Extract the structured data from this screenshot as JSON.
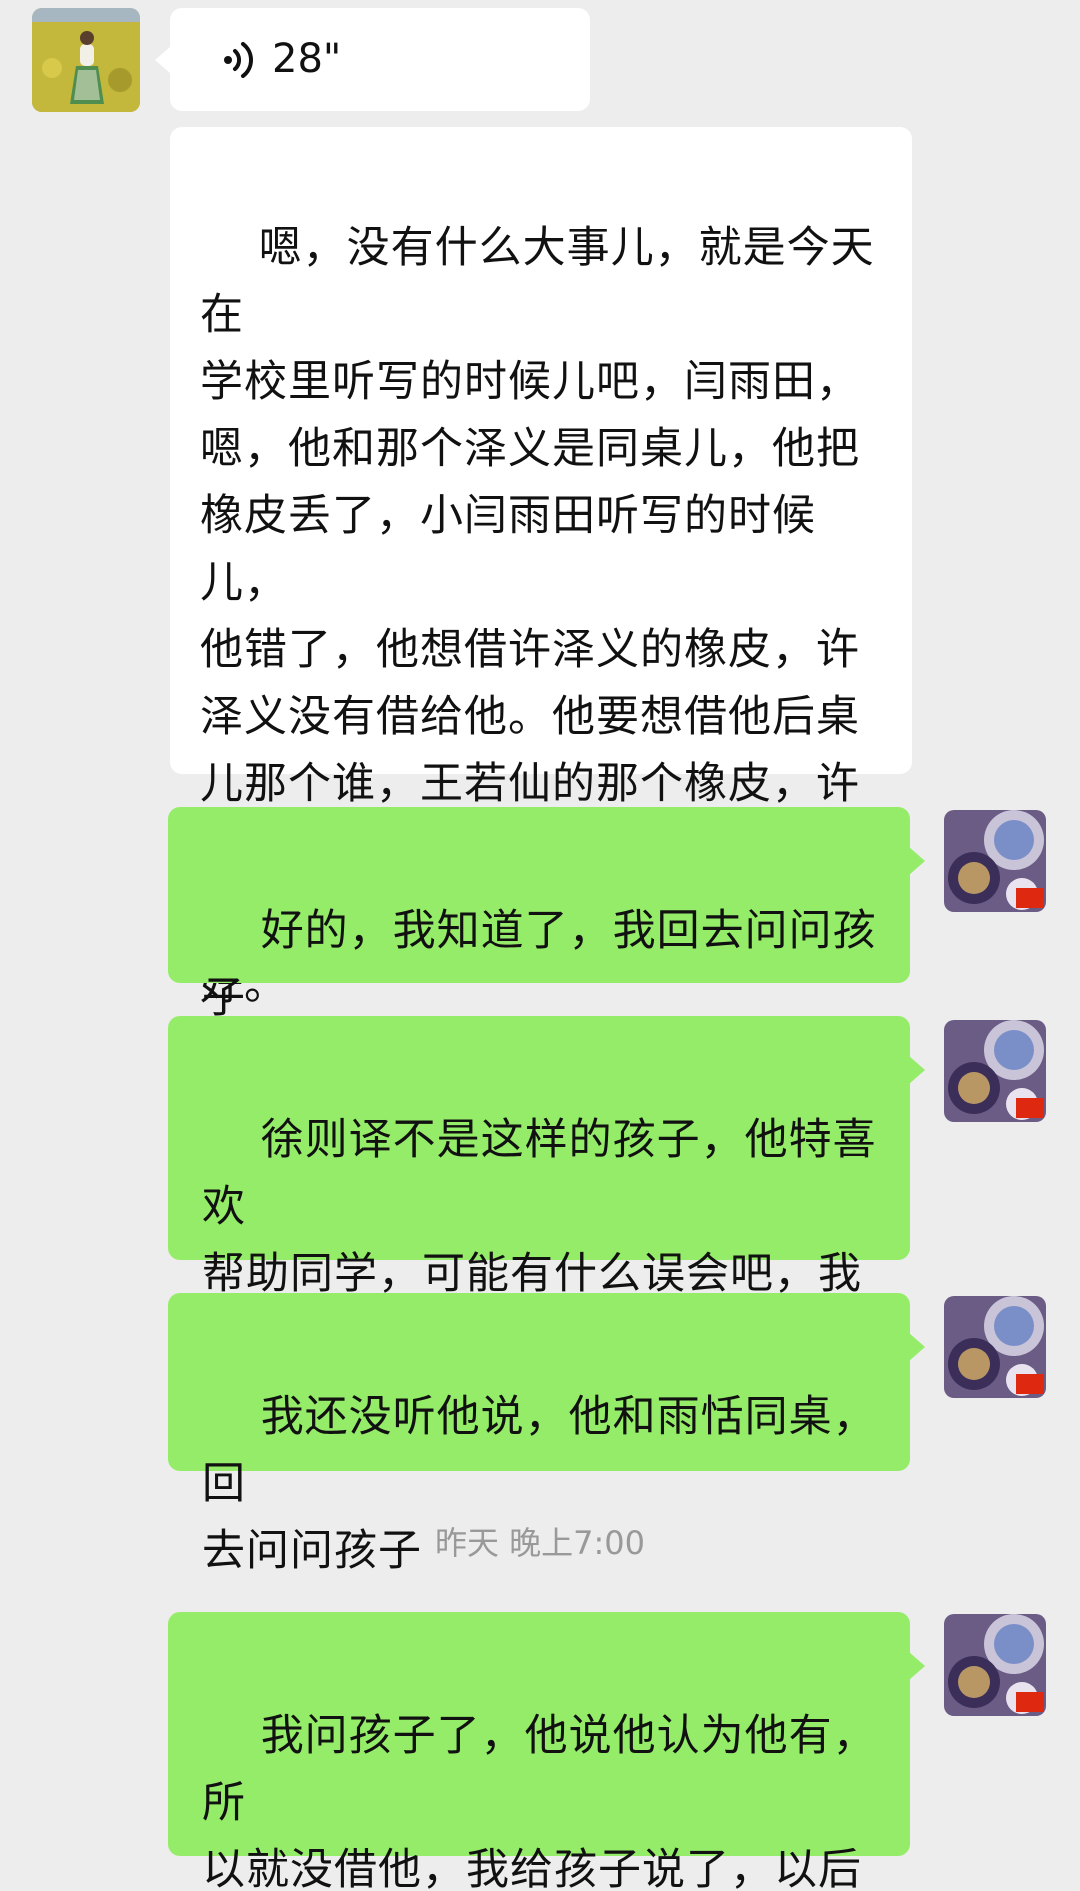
{
  "colors": {
    "background": "#ededed",
    "incoming_bubble": "#ffffff",
    "outgoing_bubble": "#95ec69",
    "timestamp_text": "#999999"
  },
  "conversation": {
    "voice_message": {
      "icon": "voice-wave-icon",
      "duration": "28\""
    },
    "incoming_text": "嗯，没有什么大事儿，就是今天在\n学校里听写的时候儿吧，闫雨田，\n嗯，他和那个泽义是同桌儿，他把\n橡皮丢了，小闫雨田听写的时候儿，\n他错了，他想借许泽义的橡皮，许\n泽义没有借给他。他要想借他后桌\n儿那个谁，王若仙的那个橡皮，许\n德义不让王若仙借给他，我说同学\n之间要互相的帮助啊，这样不太好。",
    "outgoing_messages": [
      {
        "text": "好的，我知道了，我回去问问孩子\n怎么回事再回复您"
      },
      {
        "text": "徐则译不是这样的孩子，他特喜欢\n帮助同学，可能有什么误会吧，我\n回去问问孩子。"
      },
      {
        "text": "我还没听他说，他和雨恬同桌，回\n去问问孩子"
      },
      {
        "text": "我问孩子了，他说他认为他有，所\n以就没借他，我给孩子说了，以后\n要好好相处！"
      }
    ],
    "timestamp": "昨天 晚上7:00"
  }
}
